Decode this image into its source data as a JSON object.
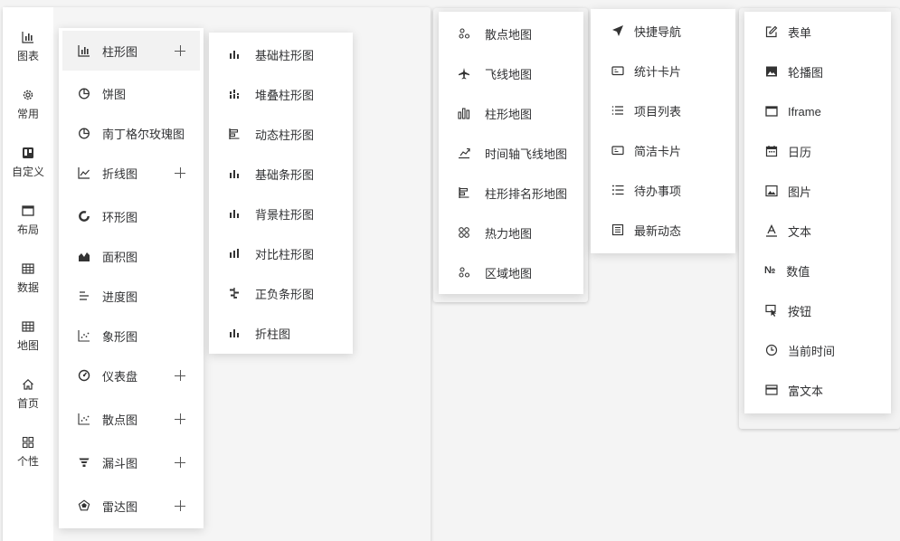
{
  "sidebar": {
    "items": [
      {
        "label": "图表",
        "icon": "bar-chart-icon"
      },
      {
        "label": "常用",
        "icon": "gear-icon"
      },
      {
        "label": "自定义",
        "icon": "trello-icon"
      },
      {
        "label": "布局",
        "icon": "window-icon"
      },
      {
        "label": "数据",
        "icon": "table-icon"
      },
      {
        "label": "地图",
        "icon": "grid-map-icon"
      },
      {
        "label": "首页",
        "icon": "home-icon"
      },
      {
        "label": "个性",
        "icon": "apps-icon"
      }
    ]
  },
  "chart_menu": {
    "items": [
      {
        "label": "柱形图",
        "icon": "bar-chart-icon",
        "expand": true
      },
      {
        "label": "饼图",
        "icon": "pie-chart-icon",
        "expand": false
      },
      {
        "label": "南丁格尔玫瑰图",
        "icon": "rose-chart-icon",
        "expand": false
      },
      {
        "label": "折线图",
        "icon": "line-chart-icon",
        "expand": true
      },
      {
        "label": "环形图",
        "icon": "ring-chart-icon",
        "expand": false
      },
      {
        "label": "面积图",
        "icon": "area-chart-icon",
        "expand": false
      },
      {
        "label": "进度图",
        "icon": "progress-chart-icon",
        "expand": false
      },
      {
        "label": "象形图",
        "icon": "pictorial-chart-icon",
        "expand": false
      },
      {
        "label": "仪表盘",
        "icon": "gauge-icon",
        "expand": true
      },
      {
        "label": "散点图",
        "icon": "scatter-chart-icon",
        "expand": true
      },
      {
        "label": "漏斗图",
        "icon": "funnel-icon",
        "expand": true
      },
      {
        "label": "雷达图",
        "icon": "radar-icon",
        "expand": true
      }
    ]
  },
  "bar_submenu": {
    "items": [
      {
        "label": "基础柱形图",
        "icon": "bar-chart-icon"
      },
      {
        "label": "堆叠柱形图",
        "icon": "stacked-bar-icon"
      },
      {
        "label": "动态柱形图",
        "icon": "dynamic-bar-icon"
      },
      {
        "label": "基础条形图",
        "icon": "bar-chart-icon"
      },
      {
        "label": "背景柱形图",
        "icon": "bar-chart-icon"
      },
      {
        "label": "对比柱形图",
        "icon": "compare-bar-icon"
      },
      {
        "label": "正负条形图",
        "icon": "pos-neg-bar-icon"
      },
      {
        "label": "折柱图",
        "icon": "bar-chart-icon"
      }
    ]
  },
  "map_menu": {
    "items": [
      {
        "label": "散点地图",
        "icon": "scatter-map-icon"
      },
      {
        "label": "飞线地图",
        "icon": "airplane-icon"
      },
      {
        "label": "柱形地图",
        "icon": "bar-map-icon"
      },
      {
        "label": "时间轴飞线地图",
        "icon": "timeline-flight-icon"
      },
      {
        "label": "柱形排名形地图",
        "icon": "ranking-bar-icon"
      },
      {
        "label": "热力地图",
        "icon": "heat-map-icon"
      },
      {
        "label": "区域地图",
        "icon": "region-map-icon"
      }
    ]
  },
  "common_menu": {
    "items": [
      {
        "label": "快捷导航",
        "icon": "navigation-icon"
      },
      {
        "label": "统计卡片",
        "icon": "card-icon"
      },
      {
        "label": "项目列表",
        "icon": "list-icon"
      },
      {
        "label": "简洁卡片",
        "icon": "card-icon"
      },
      {
        "label": "待办事项",
        "icon": "todo-icon"
      },
      {
        "label": "最新动态",
        "icon": "news-icon"
      }
    ]
  },
  "widget_menu": {
    "items": [
      {
        "label": "表单",
        "icon": "edit-icon"
      },
      {
        "label": "轮播图",
        "icon": "image-icon"
      },
      {
        "label": "Iframe",
        "icon": "window-icon"
      },
      {
        "label": "日历",
        "icon": "calendar-icon"
      },
      {
        "label": "图片",
        "icon": "picture-icon"
      },
      {
        "label": "文本",
        "icon": "text-icon"
      },
      {
        "label": "数值",
        "icon": "number-icon"
      },
      {
        "label": "按钮",
        "icon": "button-icon"
      },
      {
        "label": "当前时间",
        "icon": "clock-icon"
      },
      {
        "label": "富文本",
        "icon": "rich-text-icon"
      }
    ]
  }
}
